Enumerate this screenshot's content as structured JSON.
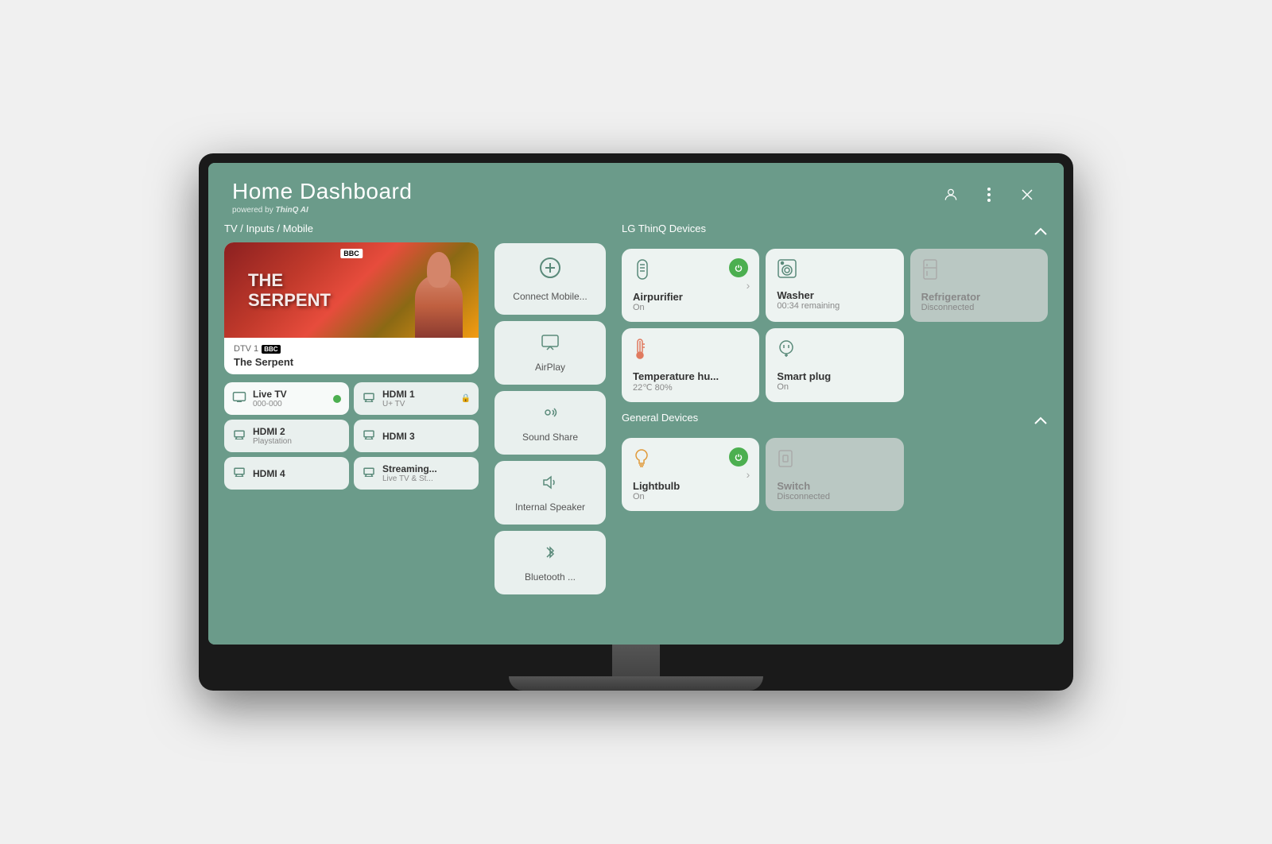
{
  "header": {
    "title": "Home Dashboard",
    "subtitle": "powered by",
    "brand": "ThinQ AI"
  },
  "tv_section": {
    "label": "TV / Inputs / Mobile",
    "current_show": {
      "channel": "DTV 1",
      "channel_badge": "BBC",
      "show_name": "The Serpent",
      "show_title_line1": "THE",
      "show_title_line2": "SERPENT"
    },
    "inputs": [
      {
        "id": "live-tv",
        "name": "Live TV",
        "sub": "000-000",
        "active": true
      },
      {
        "id": "hdmi1",
        "name": "HDMI 1",
        "sub": "U+ TV",
        "active": false
      },
      {
        "id": "hdmi2",
        "name": "HDMI 2",
        "sub": "Playstation",
        "active": false
      },
      {
        "id": "hdmi3",
        "name": "HDMI 3",
        "sub": "",
        "active": false
      },
      {
        "id": "hdmi4",
        "name": "HDMI 4",
        "sub": "",
        "active": false
      },
      {
        "id": "streaming",
        "name": "Streaming...",
        "sub": "Live TV & St...",
        "active": false
      }
    ]
  },
  "mobile_connections": [
    {
      "id": "connect-mobile",
      "label": "Connect Mobile...",
      "icon": "plus"
    },
    {
      "id": "airplay",
      "label": "AirPlay",
      "icon": "airplay"
    },
    {
      "id": "sound-share",
      "label": "Sound Share",
      "icon": "sound-share"
    },
    {
      "id": "internal-speaker",
      "label": "Internal Speaker",
      "icon": "speaker"
    },
    {
      "id": "bluetooth",
      "label": "Bluetooth ...",
      "icon": "bluetooth"
    }
  ],
  "lg_thinq_devices": {
    "section_label": "LG ThinQ Devices",
    "devices": [
      {
        "id": "airpurifier",
        "name": "Airpurifier",
        "status": "On",
        "power": true,
        "disconnected": false,
        "has_chevron": true,
        "icon": "airpurifier"
      },
      {
        "id": "washer",
        "name": "Washer",
        "status": "00:34 remaining",
        "power": false,
        "disconnected": false,
        "has_chevron": false,
        "icon": "washer"
      },
      {
        "id": "refrigerator",
        "name": "Refrigerator",
        "status": "Disconnected",
        "power": false,
        "disconnected": true,
        "has_chevron": false,
        "icon": "refrigerator"
      },
      {
        "id": "temperature",
        "name": "Temperature hu...",
        "status": "22℃ 80%",
        "power": false,
        "disconnected": false,
        "has_chevron": false,
        "icon": "temperature"
      },
      {
        "id": "smartplug",
        "name": "Smart plug",
        "status": "On",
        "power": false,
        "disconnected": false,
        "has_chevron": false,
        "icon": "smartplug"
      }
    ]
  },
  "general_devices": {
    "section_label": "General Devices",
    "devices": [
      {
        "id": "lightbulb",
        "name": "Lightbulb",
        "status": "On",
        "power": true,
        "disconnected": false,
        "has_chevron": true,
        "icon": "lightbulb"
      },
      {
        "id": "switch",
        "name": "Switch",
        "status": "Disconnected",
        "power": false,
        "disconnected": true,
        "has_chevron": false,
        "icon": "switch"
      }
    ]
  },
  "icons": {
    "user": "👤",
    "menu": "⋮",
    "close": "✕",
    "chevron_up": "︿",
    "chevron_right": "›",
    "plus": "＋",
    "airplay": "⬡",
    "speaker": "🔈",
    "bluetooth": "⦿",
    "tv": "📺",
    "hdmi": "▬",
    "check": "✓",
    "power": "⏻"
  }
}
